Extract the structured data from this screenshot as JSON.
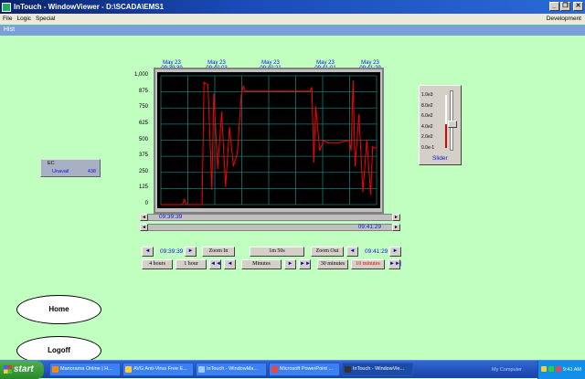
{
  "window": {
    "title": "InTouch - WindowViewer - D:\\SCADA\\EMS1"
  },
  "menu": {
    "items": [
      "File",
      "Logic",
      "Special"
    ],
    "right": "Development"
  },
  "header": {
    "label": "Hist"
  },
  "trend": {
    "x_labels": [
      {
        "date": "May 23",
        "time": "09:39:39"
      },
      {
        "date": "May 23",
        "time": "09:40:03"
      },
      {
        "date": "May 23",
        "time": "09:40:21"
      },
      {
        "date": "May 23",
        "time": "09:41:01"
      },
      {
        "date": "May 23",
        "time": "09:41:29"
      }
    ],
    "scrollbar_left_time": "09:39:39",
    "scrollbar_right_time": "09:41:29"
  },
  "chart_data": {
    "type": "line",
    "title": "",
    "xlabel": "",
    "ylabel": "",
    "x_range": [
      "09:39:39",
      "09:41:29"
    ],
    "ylim": [
      0,
      1000
    ],
    "y_ticks": [
      "1,000",
      "875",
      "750",
      "625",
      "500",
      "375",
      "250",
      "125",
      "0"
    ],
    "grid": true,
    "series": [
      {
        "color": "#ff0000",
        "x": [
          "09:39:39",
          "09:39:50",
          "09:39:51",
          "09:39:52",
          "09:40:00",
          "09:40:01",
          "09:40:03",
          "09:40:05",
          "09:40:06",
          "09:40:08",
          "09:40:10",
          "09:40:12",
          "09:40:14",
          "09:40:16",
          "09:40:18",
          "09:40:20",
          "09:40:21",
          "09:40:22",
          "09:40:40",
          "09:40:55",
          "09:40:56",
          "09:40:57",
          "09:40:58",
          "09:41:00",
          "09:41:02",
          "09:41:04",
          "09:41:10",
          "09:41:15",
          "09:41:16",
          "09:41:17",
          "09:41:18",
          "09:41:20",
          "09:41:22",
          "09:41:24",
          "09:41:26",
          "09:41:27",
          "09:41:28",
          "09:41:29"
        ],
        "values": [
          0,
          0,
          40,
          0,
          0,
          950,
          930,
          120,
          860,
          280,
          720,
          140,
          600,
          300,
          400,
          850,
          920,
          880,
          880,
          880,
          910,
          330,
          760,
          420,
          500,
          480,
          480,
          500,
          420,
          960,
          300,
          700,
          100,
          500,
          80,
          450,
          440,
          440
        ]
      }
    ]
  },
  "buttons": {
    "zoom_in": "Zoom In",
    "duration": "1m 50s",
    "zoom_out": "Zoom Out",
    "time_left": "09:39:39",
    "time_right": "09:41:29",
    "hours4": "4 hours",
    "hour1": "1 hour",
    "minutes": "Minutes",
    "min30": "30 minutes",
    "min10": "10 minutes"
  },
  "ec": {
    "label": "EC",
    "status": "Unavail",
    "value": "438"
  },
  "slider": {
    "ticks": [
      "1.0e3",
      "8.0e2",
      "6.0e2",
      "4.0e2",
      "2.0e2",
      "0.0e-1"
    ],
    "label": "Slider",
    "level": 0.45
  },
  "nav": {
    "home": "Home",
    "logoff": "Logoff"
  },
  "taskbar": {
    "start": "start",
    "tasks": [
      "Manorama Online | H...",
      "AVG Anti-Virus Free E...",
      "InTouch - WindowMa...",
      "Microsoft PowerPoint ...",
      "InTouch - WindowVie..."
    ],
    "my_computer": "My Computer",
    "clock": "9:41 AM"
  },
  "colors": {
    "background": "#c0ffc0",
    "trace": "#ff0000",
    "grid": "#1a7a7a",
    "time_text": "#1010e0"
  }
}
